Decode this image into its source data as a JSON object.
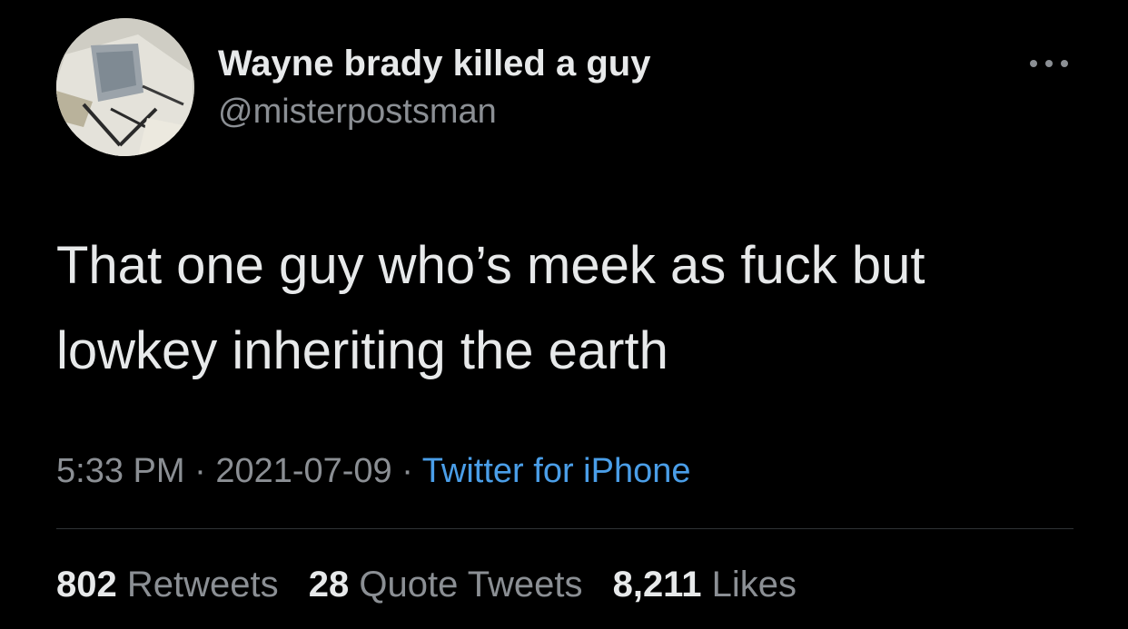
{
  "user": {
    "display_name": "Wayne brady killed a guy",
    "handle": "@misterpostsman"
  },
  "tweet": {
    "text": "That one guy who’s meek as fuck but lowkey inheriting the earth",
    "time": "5:33 PM",
    "date": "2021-07-09",
    "separator": "·",
    "source": "Twitter for iPhone"
  },
  "stats": {
    "retweets": {
      "count": "802",
      "label": "Retweets"
    },
    "quotes": {
      "count": "28",
      "label": "Quote Tweets"
    },
    "likes": {
      "count": "8,211",
      "label": "Likes"
    }
  },
  "icons": {
    "more": "more-horizontal-icon"
  },
  "colors": {
    "background": "#000000",
    "text_primary": "#e7e9ea",
    "text_secondary": "#8b8f94",
    "link": "#4a9ee8",
    "divider": "#2f3336"
  }
}
